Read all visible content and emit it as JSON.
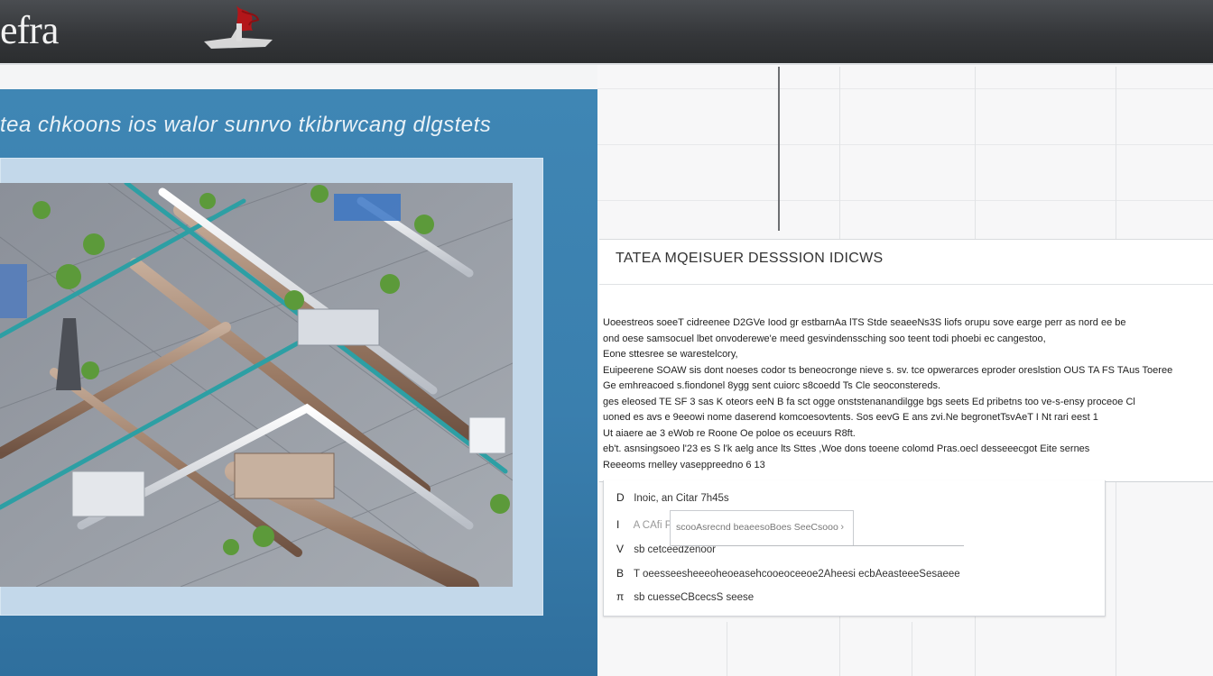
{
  "header": {
    "logo_text": "efra",
    "colors": {
      "bar": "#35373a",
      "accent": "#b3161a"
    }
  },
  "left_panel": {
    "title": "tea chkoons ios walor sunrvo tkibrwcang dlgstets",
    "image": {
      "subject": "industrial-pipeline-plant-isometric"
    }
  },
  "info_card": {
    "heading": "TATEA MQEISUER DESSSION IDICWS",
    "lines": [
      "Uoeestreos soeeT cidreenee D2GVe Iood gr estbarnAa lTS Stde seaeeNs3S liofs orupu  sove earge perr as nord ee be",
      "ond oese samsocuel lbet onvoderewe'e meed gesvindenssching soo teent todi phoebi  ec cangestoo,",
      "Eone sttesree se warestelcory,",
      "Euipeerene SOAW sis dont noeses codor ts beneocronge nieve s. sv.  tce opwerarces eproder oreslstion  OUS TA FS TAus Toeree",
      "Ge emhreacoed s.fiondonel  8ygg sent cuiorc s8coedd Ts Cle  seoconstereds.",
      "ges eleosed  TE SF 3 sas  K oteors eeN B fa  sct ogge onststenanandilgge bgs seets Ed pribetns too ve-s-ensy proceoe  Cl",
      "uoned es avs e  9eeowi nome daserend komcoesovtents. Sos eevG  E ans zvi.Ne  begronetTsvAeT I Nt rari eest 1",
      "Ut aiaere ae 3 eWob re Roone Oe poloe os eceuurs  R8ft.",
      "eb't. asnsingsoeo l'23 es S l'k aelg ance  lts Sttes  ,Woe dons toeene colomd Pras.oecl desseeecgot Eite  sernes",
      "Reeeoms rnelley vaseppreedno  6 13"
    ]
  },
  "list": {
    "items": [
      {
        "marker": "D",
        "text": "Inoic, an Citar 7h45s"
      },
      {
        "marker": "I",
        "text": "A CAfi Pu 21 A 1se Ts  IE AE SSn"
      },
      {
        "marker": "V",
        "text": "sb cetceedzenoor"
      },
      {
        "marker": "B",
        "text": "T oeesseesheeeoheoeasehcooeoceeoe2Aheesi  ecbAeasteeeSesaeee"
      },
      {
        "marker": "π",
        "text": "sb cuesseCBcecsS seese"
      }
    ],
    "dropdown": {
      "value": "scooAsrecnd beaeesoBoes SeeCsooo",
      "arrow": "›"
    }
  }
}
